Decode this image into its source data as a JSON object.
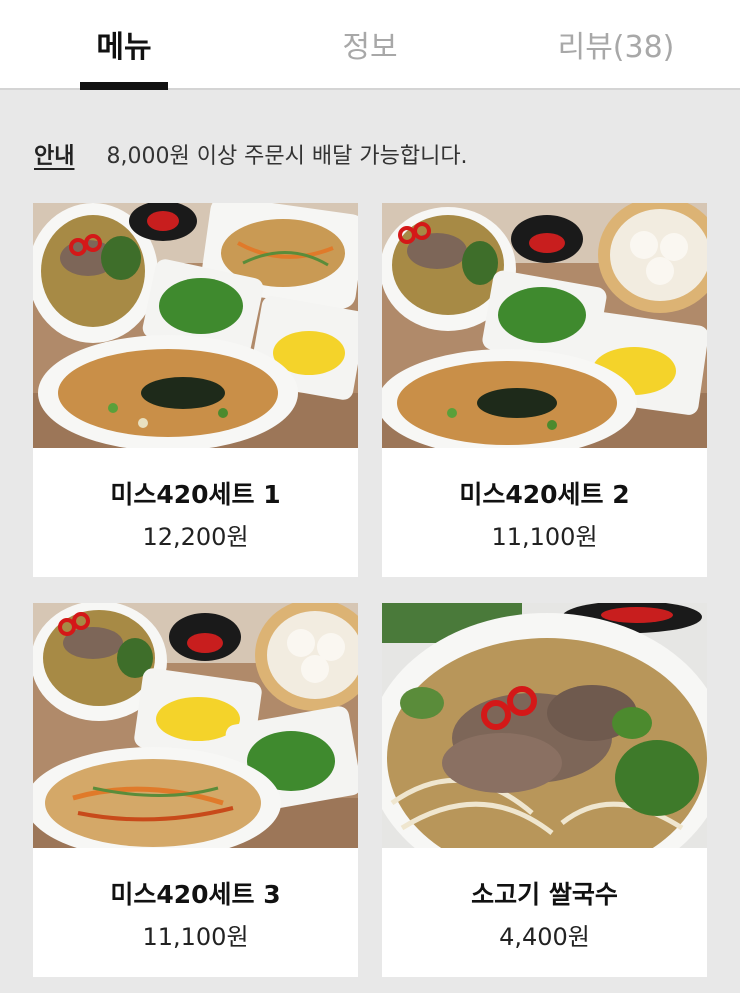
{
  "tabs": [
    {
      "label": "메뉴",
      "active": true
    },
    {
      "label": "정보",
      "active": false
    },
    {
      "label": "리뷰(38)",
      "active": false
    }
  ],
  "notice": {
    "label": "안내",
    "text": "8,000원 이상 주문시 배달 가능합니다."
  },
  "menu": [
    {
      "name": "미스420세트 1",
      "price": "12,200원",
      "photo": "set1-photo-icon"
    },
    {
      "name": "미스420세트 2",
      "price": "11,100원",
      "photo": "set2-photo-icon"
    },
    {
      "name": "미스420세트 3",
      "price": "11,100원",
      "photo": "set3-photo-icon"
    },
    {
      "name": "소고기 쌀국수",
      "price": "4,400원",
      "photo": "beef-pho-photo-icon"
    }
  ]
}
